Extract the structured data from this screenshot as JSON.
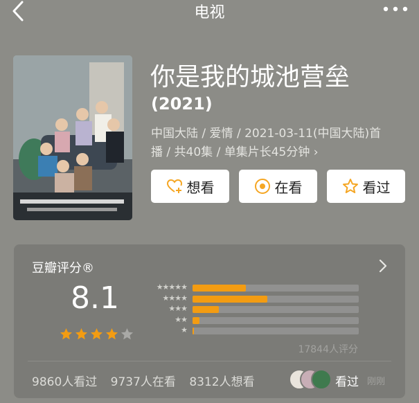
{
  "header": {
    "title": "电视",
    "back_icon": "chevron-left-icon",
    "more_icon": "more-dots-icon"
  },
  "movie": {
    "title": "你是我的城池营垒",
    "year": "(2021)",
    "meta_line1": "中国大陆 / 爱情 / 2021-03-11(中国大陆)首",
    "meta_line2": "播 / 共40集 / 单集片长45分钟 ›"
  },
  "actions": {
    "want_label": "想看",
    "watching_label": "在看",
    "watched_label": "看过"
  },
  "rating": {
    "title": "豆瓣评分®",
    "score": "8.1",
    "stars_filled": 4,
    "stars_total": 5,
    "distribution": [
      {
        "stars": 5,
        "label": "★★★★★",
        "fraction": 0.32
      },
      {
        "stars": 4,
        "label": "★★★★",
        "fraction": 0.45
      },
      {
        "stars": 3,
        "label": "★★★",
        "fraction": 0.16
      },
      {
        "stars": 2,
        "label": "★★",
        "fraction": 0.04
      },
      {
        "stars": 1,
        "label": "★",
        "fraction": 0.01
      }
    ],
    "count_text": "17844人评分",
    "watched_count": "9860人看过",
    "watching_count": "9737人在看",
    "want_count": "8312人想看",
    "friend_seen_label": "看过",
    "friend_seen_time": "刚刚"
  },
  "colors": {
    "background": "#8c8c87",
    "accent": "#f39c12",
    "card": "#7b7b77"
  }
}
